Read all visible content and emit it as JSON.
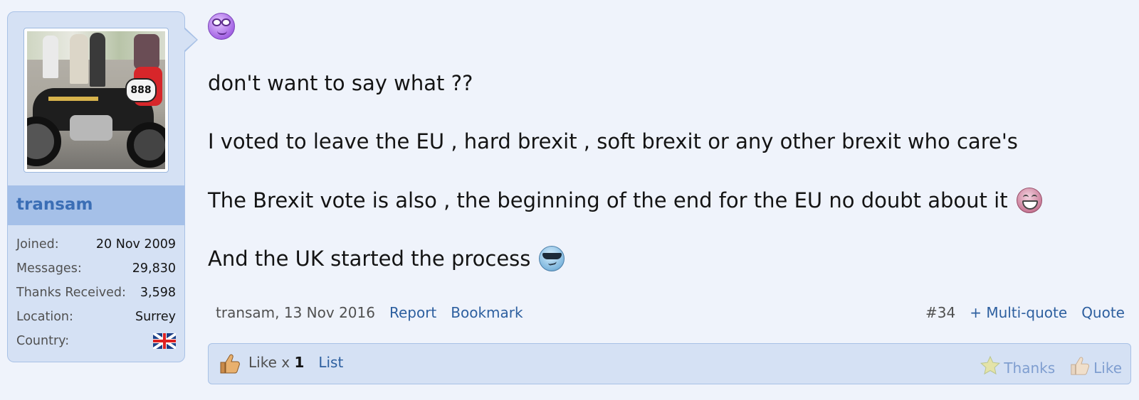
{
  "user": {
    "username": "transam",
    "stats": [
      {
        "label": "Joined:",
        "value": "20 Nov 2009"
      },
      {
        "label": "Messages:",
        "value": "29,830"
      },
      {
        "label": "Thanks Received:",
        "value": "3,598"
      },
      {
        "label": "Location:",
        "value": "Surrey"
      }
    ],
    "country_label": "Country:",
    "country_flag": "uk-flag-icon",
    "avatar_plate_number": "888"
  },
  "message": {
    "lines": [
      "don't want to say what ??",
      "I voted to leave the EU , hard brexit , soft brexit or any other brexit who care's",
      "The Brexit vote is also , the beginning of the end for the EU no doubt about it",
      "And the UK started the process"
    ],
    "smilies": [
      "glasses-smilie-icon",
      "laughing-smilie-icon",
      "cool-smilie-icon"
    ]
  },
  "meta": {
    "author_date": "transam, 13 Nov 2016",
    "report": "Report",
    "bookmark": "Bookmark",
    "post_number": "#34",
    "multi_quote": "+ Multi-quote",
    "quote": "Quote"
  },
  "likes": {
    "prefix": "Like x",
    "count": "1",
    "list": "List",
    "thanks": "Thanks",
    "like": "Like"
  },
  "colors": {
    "page_bg": "#eff3fb",
    "panel_bg": "#d5e1f4",
    "username": "#3b6eb5",
    "link": "#2d5f9f"
  }
}
